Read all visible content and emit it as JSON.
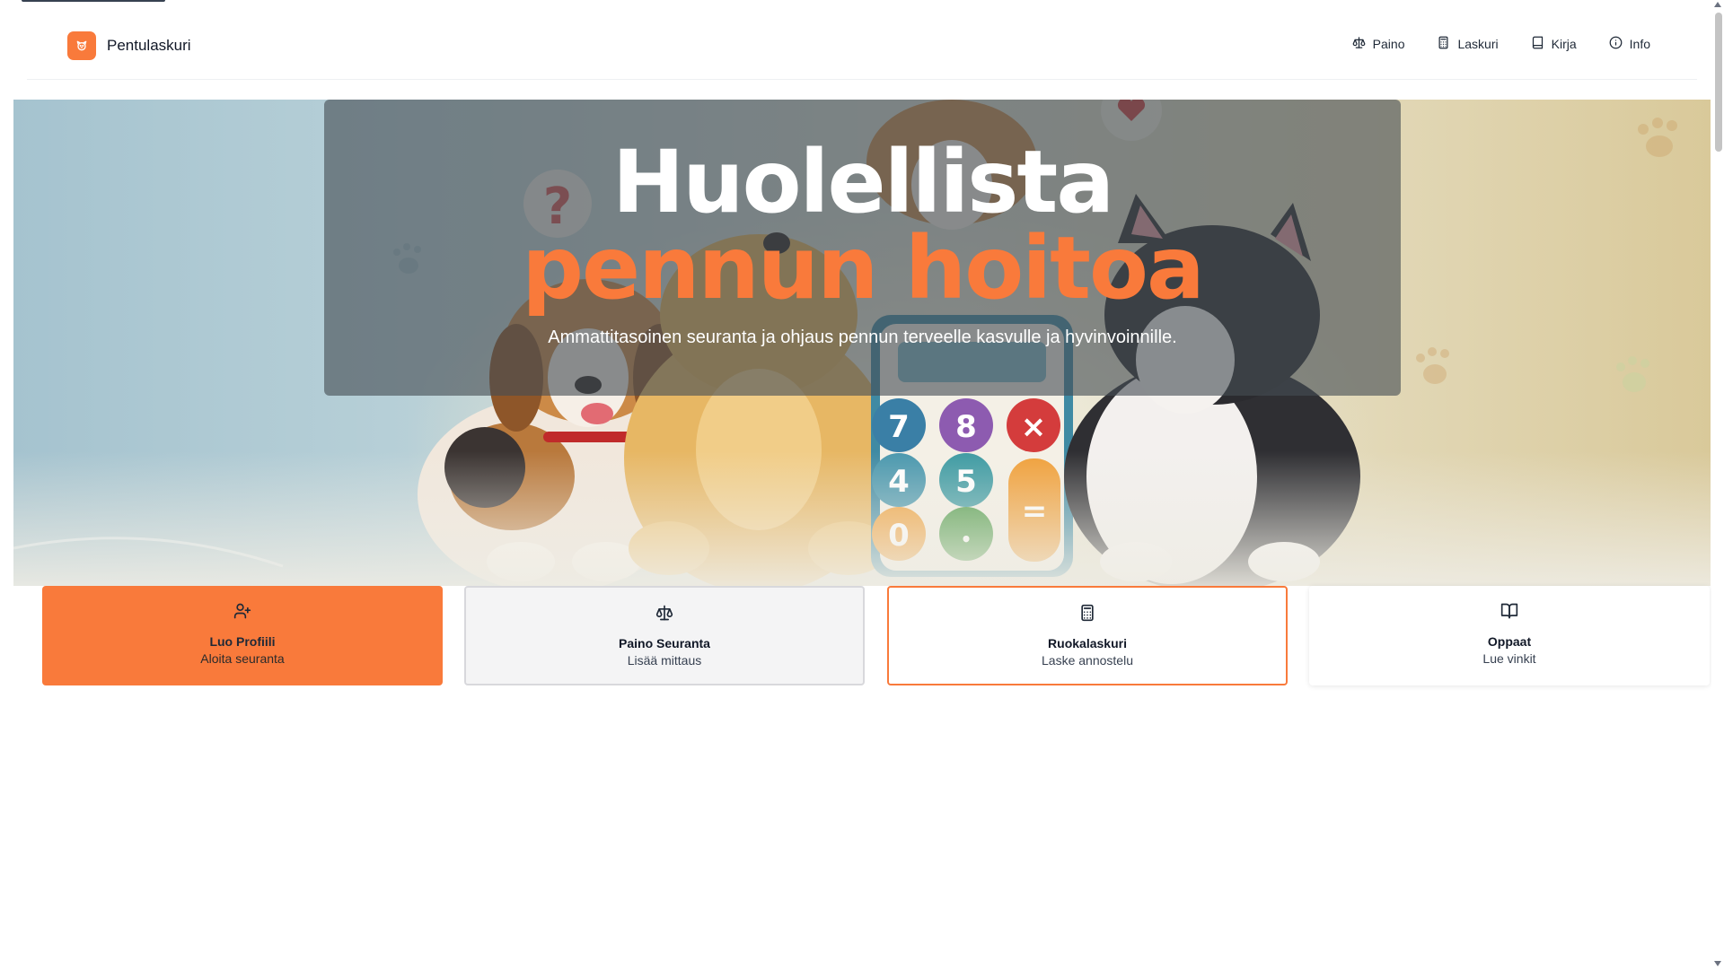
{
  "app": {
    "brand_name": "Pentulaskuri",
    "accent_color": "#f97a3b"
  },
  "nav": {
    "items": [
      {
        "label": "Paino",
        "icon": "scale-icon"
      },
      {
        "label": "Laskuri",
        "icon": "calculator-icon"
      },
      {
        "label": "Kirja",
        "icon": "book-icon"
      },
      {
        "label": "Info",
        "icon": "info-icon"
      }
    ]
  },
  "hero": {
    "title_line1": "Huolellista",
    "title_line2": "pennun hoitoa",
    "subtitle": "Ammattitasoinen seuranta ja ohjaus pennun terveelle kasvulle ja hyvinvoinnille.",
    "calculator_keys": [
      "7",
      "8",
      "×",
      "4",
      "5",
      "=",
      "0",
      "•"
    ]
  },
  "cards": [
    {
      "title": "Luo Profiili",
      "subtitle": "Aloita seuranta",
      "icon": "user-plus-icon"
    },
    {
      "title": "Paino Seuranta",
      "subtitle": "Lisää mittaus",
      "icon": "scale-icon"
    },
    {
      "title": "Ruokalaskuri",
      "subtitle": "Laske annostelu",
      "icon": "calculator-icon"
    },
    {
      "title": "Oppaat",
      "subtitle": "Lue vinkit",
      "icon": "book-open-icon"
    }
  ]
}
